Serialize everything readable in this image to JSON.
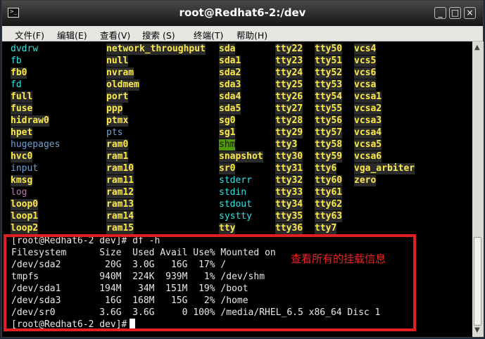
{
  "window": {
    "title": "root@Redhat6-2:/dev",
    "icon": "terminal-icon",
    "controls": {
      "minimize": "_",
      "maximize": "□",
      "close": "×"
    }
  },
  "menu": [
    "文件(F)",
    "编辑(E)",
    "查看(V)",
    "搜索 (S)",
    "终端(T)",
    "帮助(H)"
  ],
  "listing": {
    "col1": [
      {
        "t": "dvdrw",
        "s": "cyan"
      },
      {
        "t": "fb",
        "s": "cyan"
      },
      {
        "t": "fb0",
        "s": "bg"
      },
      {
        "t": "fd",
        "s": "cyan"
      },
      {
        "t": "full",
        "s": "bg"
      },
      {
        "t": "fuse",
        "s": "bg"
      },
      {
        "t": "hidraw0",
        "s": "bg"
      },
      {
        "t": "hpet",
        "s": "bg"
      },
      {
        "t": "hugepages",
        "s": "blue"
      },
      {
        "t": "hvc0",
        "s": "bg"
      },
      {
        "t": "input",
        "s": "blue"
      },
      {
        "t": "kmsg",
        "s": "bg"
      },
      {
        "t": "log",
        "s": "mag"
      },
      {
        "t": "loop0",
        "s": "bg"
      },
      {
        "t": "loop1",
        "s": "bg"
      },
      {
        "t": "loop2",
        "s": "bg"
      }
    ],
    "col2": [
      {
        "t": "network_throughput",
        "s": "bg"
      },
      {
        "t": "null",
        "s": "bg"
      },
      {
        "t": "nvram",
        "s": "bg"
      },
      {
        "t": "oldmem",
        "s": "bg"
      },
      {
        "t": "port",
        "s": "bg"
      },
      {
        "t": "ppp",
        "s": "bg"
      },
      {
        "t": "ptmx",
        "s": "bg"
      },
      {
        "t": "pts",
        "s": "blue"
      },
      {
        "t": "ram0",
        "s": "bg"
      },
      {
        "t": "ram1",
        "s": "bg"
      },
      {
        "t": "ram10",
        "s": "bg"
      },
      {
        "t": "ram11",
        "s": "bg"
      },
      {
        "t": "ram12",
        "s": "bg"
      },
      {
        "t": "ram13",
        "s": "bg"
      },
      {
        "t": "ram14",
        "s": "bg"
      },
      {
        "t": "ram15",
        "s": "bg"
      }
    ],
    "col3": [
      {
        "t": "sda",
        "s": "bg"
      },
      {
        "t": "sda1",
        "s": "bg"
      },
      {
        "t": "sda2",
        "s": "bg"
      },
      {
        "t": "sda3",
        "s": "bg"
      },
      {
        "t": "sda4",
        "s": "bg"
      },
      {
        "t": "sda5",
        "s": "bg"
      },
      {
        "t": "sg0",
        "s": "bg"
      },
      {
        "t": "sg1",
        "s": "bg"
      },
      {
        "t": "shm",
        "s": "bgg"
      },
      {
        "t": "snapshot",
        "s": "bg"
      },
      {
        "t": "sr0",
        "s": "bg"
      },
      {
        "t": "stderr",
        "s": "cyan"
      },
      {
        "t": "stdin",
        "s": "cyan"
      },
      {
        "t": "stdout",
        "s": "cyan"
      },
      {
        "t": "systty",
        "s": "cyan"
      },
      {
        "t": "tty",
        "s": "bg"
      }
    ],
    "col4": [
      {
        "t": "tty22",
        "s": "bg"
      },
      {
        "t": "tty23",
        "s": "bg"
      },
      {
        "t": "tty24",
        "s": "bg"
      },
      {
        "t": "tty25",
        "s": "bg"
      },
      {
        "t": "tty26",
        "s": "bg"
      },
      {
        "t": "tty27",
        "s": "bg"
      },
      {
        "t": "tty28",
        "s": "bg"
      },
      {
        "t": "tty29",
        "s": "bg"
      },
      {
        "t": "tty3",
        "s": "bg"
      },
      {
        "t": "tty30",
        "s": "bg"
      },
      {
        "t": "tty31",
        "s": "bg"
      },
      {
        "t": "tty32",
        "s": "bg"
      },
      {
        "t": "tty33",
        "s": "bg"
      },
      {
        "t": "tty34",
        "s": "bg"
      },
      {
        "t": "tty35",
        "s": "bg"
      },
      {
        "t": "tty36",
        "s": "bg"
      }
    ],
    "col5": [
      {
        "t": "tty50",
        "s": "bg"
      },
      {
        "t": "tty51",
        "s": "bg"
      },
      {
        "t": "tty52",
        "s": "bg"
      },
      {
        "t": "tty53",
        "s": "bg"
      },
      {
        "t": "tty54",
        "s": "bg"
      },
      {
        "t": "tty55",
        "s": "bg"
      },
      {
        "t": "tty56",
        "s": "bg"
      },
      {
        "t": "tty57",
        "s": "bg"
      },
      {
        "t": "tty58",
        "s": "bg"
      },
      {
        "t": "tty59",
        "s": "bg"
      },
      {
        "t": "tty6",
        "s": "bg"
      },
      {
        "t": "tty60",
        "s": "bg"
      },
      {
        "t": "tty61",
        "s": "bg"
      },
      {
        "t": "tty62",
        "s": "bg"
      },
      {
        "t": "tty63",
        "s": "bg"
      },
      {
        "t": "tty7",
        "s": "bg"
      }
    ],
    "col6": [
      {
        "t": "vcs4",
        "s": "bg"
      },
      {
        "t": "vcs5",
        "s": "bg"
      },
      {
        "t": "vcs6",
        "s": "bg"
      },
      {
        "t": "vcsa",
        "s": "bg"
      },
      {
        "t": "vcsa1",
        "s": "bg"
      },
      {
        "t": "vcsa2",
        "s": "bg"
      },
      {
        "t": "vcsa3",
        "s": "bg"
      },
      {
        "t": "vcsa4",
        "s": "bg"
      },
      {
        "t": "vcsa5",
        "s": "bg"
      },
      {
        "t": "vcsa6",
        "s": "bg"
      },
      {
        "t": "vga_arbiter",
        "s": "bg"
      },
      {
        "t": "zero",
        "s": "bg"
      }
    ]
  },
  "df": {
    "command_line": "[root@Redhat6-2 dev]# df -h",
    "header": "Filesystem      Size  Used Avail Use% Mounted on",
    "rows": [
      "/dev/sda2        20G  3.0G   16G  17% /",
      "tmpfs           940M  224K  939M   1% /dev/shm",
      "/dev/sda1       194M   34M  151M  19% /boot",
      "/dev/sda3        16G  168M   15G   2% /home",
      "/dev/sr0        3.6G  3.6G     0 100% /media/RHEL_6.5 x86_64 Disc 1"
    ],
    "prompt": "[root@Redhat6-2 dev]#"
  },
  "annotation": "查看所有的挂载信息",
  "colors": {
    "dir_blue": "#729fcf",
    "link_cyan": "#34e2e2",
    "device_yellow": "#fcea4b",
    "device_bg": "#2b2b2b",
    "sticky_green": "#4e9a06",
    "highlight_red": "#e02020"
  }
}
